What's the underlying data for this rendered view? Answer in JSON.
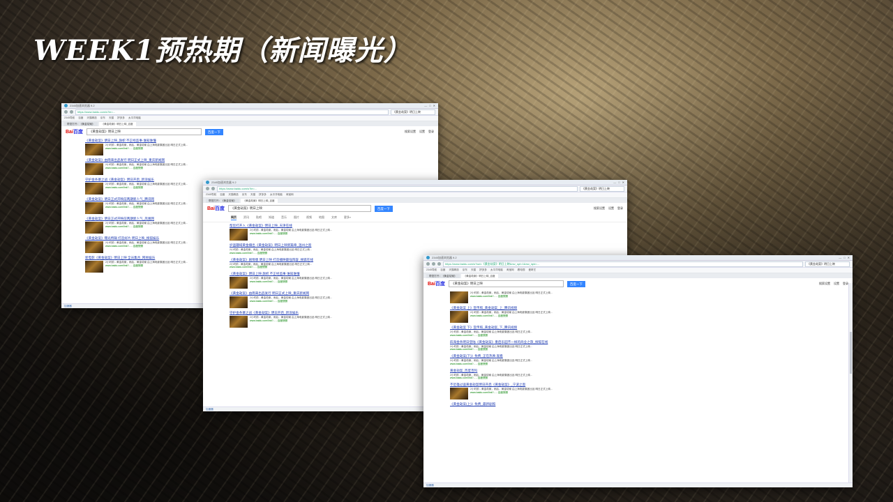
{
  "slide": {
    "title": "WEEK1预热期（新闻曝光）"
  },
  "browser": {
    "window_title": "2345加速浏览器 9.2",
    "url_short": "https://www.baidu.com/s?ie=...",
    "url_long": "https://www.baidu.com/s?wd=《黄金劫案》明日上映&rsv_spt=1&rsv_iqid=...",
    "address_search": "《黄金劫案》明日上映",
    "bookmarks": [
      "2345导航",
      "百度",
      "天猫精选",
      "京东",
      "天猫",
      "拼多多",
      "太平洋电脑",
      "淘宝网",
      "看电视",
      "爱奇艺"
    ],
    "tabs": [
      "帮您打开：《黄金劫案》",
      "《黄金劫案》明日上映_百度"
    ],
    "logo_red": "Bai",
    "logo_blue": "百度",
    "query": "《黄金劫案》明日上映",
    "search_button": "百度一下",
    "top_links": [
      "搜索设置",
      "设置",
      "登录"
    ],
    "search_tabs": [
      "网页",
      "资讯",
      "贴吧",
      "知道",
      "音乐",
      "图片",
      "视频",
      "地图",
      "文库",
      "更多»"
    ],
    "status_text": "加速器",
    "result_snippet": "2小时前 - 黄金劫案，雨后，黄金劫案 由上海电影集团出品 明日正式上映...",
    "result_url": "www.baidu.com/link?... - 百度快照"
  },
  "results_a": [
    "《黄金劫案》明日上映_旗帜 不正经监事·谁知谁懂",
    "《黄金劫案》由雨来出品发行 明日正式上映_重庆新闻网",
    "守护金条寨之战《黄金劫案》明日开启_新浪娱乐",
    "《黄金劫案》明日正式开映前两期新人气_腾讯网",
    "《黄金劫案》明日正式开映前两期新人气_凤凰网",
    "《黄金劫案》曝光特辑 打造好片 明日上映_搜狐娱乐",
    "新电影《黄金劫案》明日上映 全员集合_网易娱乐",
    "雨前时期《黄金劫案》明日热映_头条新闻"
  ],
  "results_b": [
    "帮您打开入《黄金劫案》明日上映_天津在线",
    "护盗疆域黄金播出《黄金劫案》明日上映新篇章_温州之窗",
    "《黄金劫案》剧情版 明日上映 打造播映最强阵容_搜狐在线",
    "《黄金劫案》明日上映 旗帜 不正经监事·谁知谁懂",
    "《黄金劫案》由雨来出品发行 明日正式上映_重庆新闻网",
    "守护金条寨之战《黄金劫案》明日开启_新浪娱乐",
    "《黄金劫案》明日正式开映前两期新人气_腾讯网"
  ],
  "results_c": [
    "《黄金劫案》明日上映_百度百科",
    "《黄金劫案 上》宣传照_黄金劫案_上_腾讯视频",
    "《黄金劫案 下》宣传照_黄金劫案_下_腾讯视频",
    "四海金条明日登陆《黄金劫案》重启乐园不一样的商业之旅_搜狐在线",
    "《黄金劫案(下)》免费_正在热映 观看",
    "黄金劫案(下) 电影 最新_资讯",
    "黄金劫案_百度百科",
    "不近雄过盗黄金劫案明日开启《黄金劫案》_宁波之窗",
    "《黄金劫案(上)》免费_最新剧照"
  ]
}
